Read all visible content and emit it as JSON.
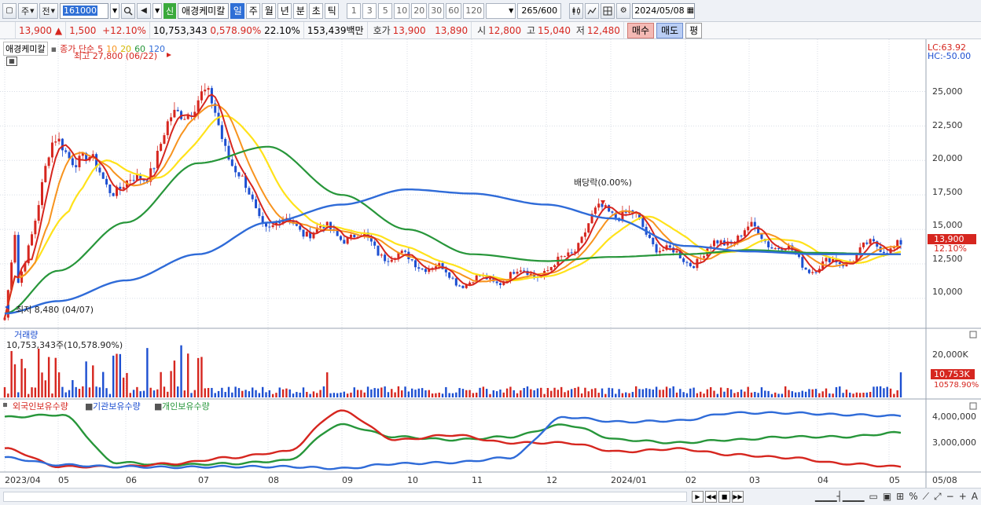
{
  "toolbar": {
    "period_type": "주",
    "market_label": "전",
    "code": "161000",
    "sin_badge": "신",
    "stock_name": "애경케미칼",
    "periods": [
      "일",
      "주",
      "월",
      "년",
      "분",
      "초",
      "틱"
    ],
    "active_period": "일",
    "intervals": [
      "1",
      "3",
      "5",
      "10",
      "20",
      "30",
      "60",
      "120"
    ],
    "count": "265/600",
    "date": "2024/05/08"
  },
  "quote": {
    "price": "13,900",
    "change_arrow": "▲",
    "change": "1,500",
    "change_pct": "+12.10%",
    "volume": "10,753,343",
    "vol_ratio": "0,578.90%",
    "turnover": "22.10%",
    "amount": "153,439백만",
    "hoga_label": "호가",
    "ask": "13,900",
    "bid": "13,890",
    "open_label": "시",
    "open": "12,800",
    "high_label": "고",
    "high": "15,040",
    "low_label": "저",
    "low": "12,480",
    "buy_label": "매수",
    "sell_label": "매도",
    "eval_label": "평"
  },
  "price_panel": {
    "stock_label": "애경케미칼",
    "ma_label": "종가 단순",
    "ma_periods": [
      {
        "label": "5",
        "color": "#d6261f"
      },
      {
        "label": "10",
        "color": "#f7931e"
      },
      {
        "label": "20",
        "color": "#ffe21a"
      },
      {
        "label": "60",
        "color": "#27963a"
      },
      {
        "label": "120",
        "color": "#2f6bd8"
      }
    ],
    "high_note": "최고 27,800 (06/22)",
    "low_note": "최저 8,480 (04/07)",
    "dividend_note": "배당락(0.00%)",
    "lc": "LC:63.92",
    "hc": "HC:-50.00",
    "yticks": [
      "25,000",
      "22,500",
      "20,000",
      "17,500",
      "15,000",
      "12,500",
      "10,000"
    ],
    "current_price": "13,900",
    "current_pct": "12.10%"
  },
  "volume_panel": {
    "title": "거래량",
    "summary": "10,753,343주(10,578.90%)",
    "ytick": "20,000K",
    "current_volume": "10,753K",
    "current_pct": "10578.90%"
  },
  "holding_panel": {
    "legend": [
      {
        "label": "외국인보유수량",
        "color": "#d6261f"
      },
      {
        "label": "기관보유수량",
        "color": "#2f6bd8"
      },
      {
        "label": "개인보유수량",
        "color": "#27963a"
      }
    ],
    "yticks": [
      "4,000,000",
      "3,000,000"
    ]
  },
  "xaxis": {
    "labels": [
      "2023/04",
      "05",
      "06",
      "07",
      "08",
      "09",
      "10",
      "11",
      "12",
      "2024/01",
      "02",
      "03",
      "04",
      "05",
      "05/08"
    ]
  },
  "colors": {
    "up": "#d6261f",
    "down": "#1d4fd1",
    "ma5": "#d6261f",
    "ma10": "#f7931e",
    "ma20": "#ffe21a",
    "ma60": "#27963a",
    "ma120": "#2f6bd8"
  },
  "chart_data": {
    "type": "line",
    "title": "",
    "x": [
      "2023/04",
      "05",
      "06",
      "07",
      "08",
      "09",
      "10",
      "11",
      "12",
      "2024/01",
      "02",
      "03",
      "04",
      "05"
    ],
    "series": [
      {
        "name": "종가",
        "values": [
          8900,
          21000,
          18000,
          24500,
          15500,
          14700,
          12800,
          11200,
          12000,
          16500,
          12800,
          14800,
          12300,
          13900
        ]
      },
      {
        "name": "60",
        "values": [
          8900,
          12000,
          15500,
          19800,
          21000,
          17500,
          15000,
          13200,
          12700,
          13000,
          13200,
          13500,
          13300,
          13200
        ]
      },
      {
        "name": "120",
        "values": [
          8900,
          9800,
          11300,
          13200,
          15500,
          16800,
          17900,
          17600,
          16800,
          15800,
          13800,
          13400,
          13200,
          13200
        ]
      }
    ],
    "ylim": [
      8000,
      28500
    ]
  }
}
